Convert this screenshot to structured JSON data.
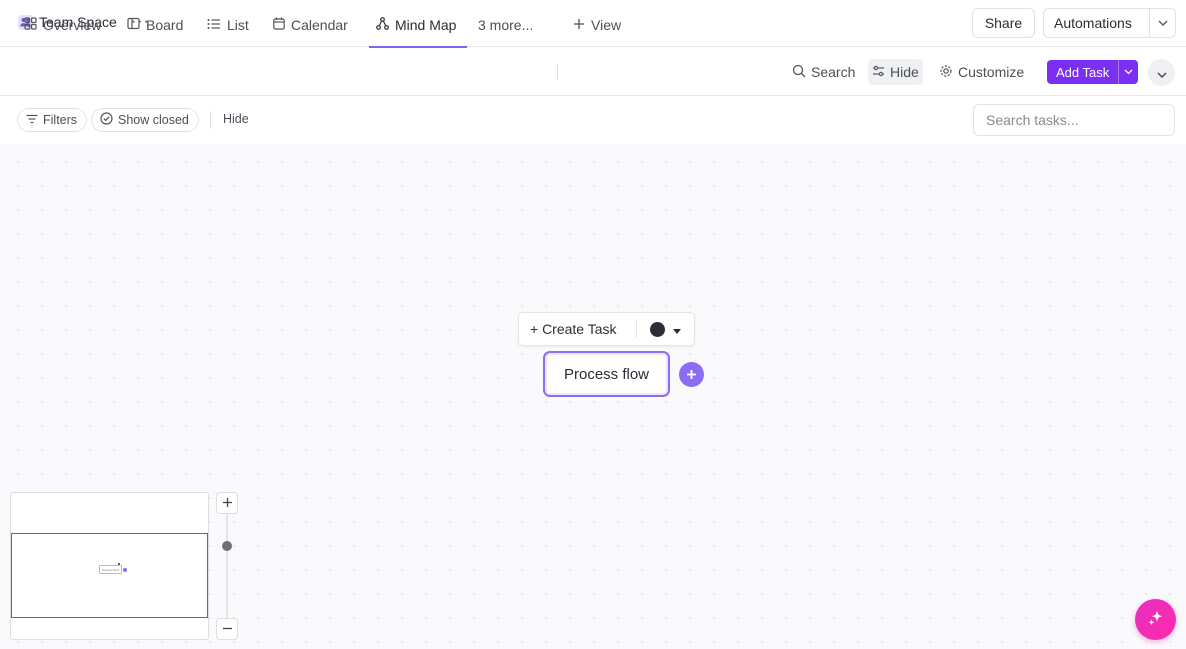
{
  "header": {
    "space_name": "Team Space",
    "more_label": "···",
    "share_label": "Share",
    "automations_label": "Automations"
  },
  "views": {
    "tabs": [
      {
        "label": "Overview",
        "icon": "overview-icon"
      },
      {
        "label": "Board",
        "icon": "board-icon"
      },
      {
        "label": "List",
        "icon": "list-icon"
      },
      {
        "label": "Calendar",
        "icon": "calendar-icon"
      },
      {
        "label": "Mind Map",
        "icon": "mind-map-icon",
        "active": true
      }
    ],
    "more_label": "3 more...",
    "add_view_label": "View",
    "search_label": "Search",
    "hide_label": "Hide",
    "customize_label": "Customize",
    "add_task_label": "Add Task"
  },
  "filters": {
    "filters_label": "Filters",
    "show_closed_label": "Show closed",
    "hide_label": "Hide",
    "search_placeholder": "Search tasks..."
  },
  "mindmap": {
    "create_task_label": "+ Create Task",
    "node_label": "Process flow",
    "minimap_node_label": "Process flow"
  },
  "colors": {
    "accent": "#7b68ee",
    "add_task_bg": "#7b2ff0",
    "minimap_viewport": "#d21ee0",
    "ai_button": "#e62fc4"
  }
}
